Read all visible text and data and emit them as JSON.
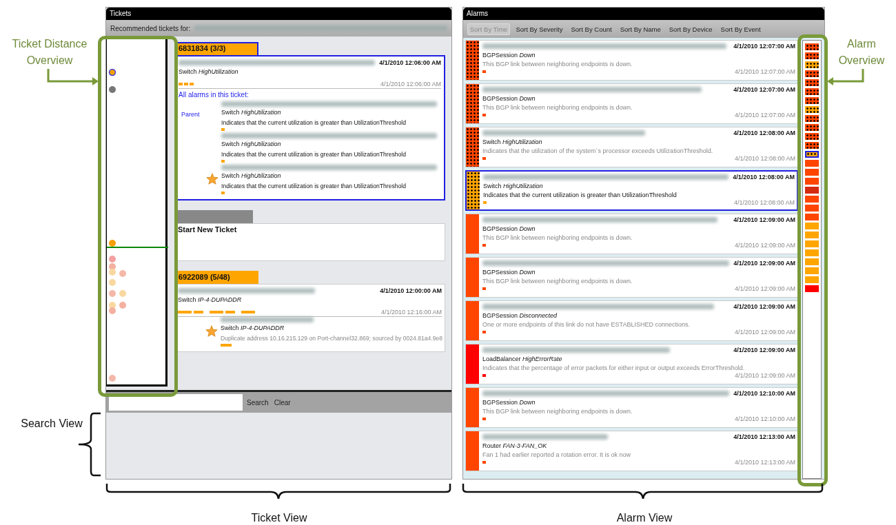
{
  "tickets_panel": {
    "title": "Tickets",
    "recommended_label": "Recommended tickets for:",
    "tickets": [
      {
        "kind": "ticket",
        "header": "6831834 (3/3)",
        "selected": true,
        "time": "4/1/2010 12:06:00 AM",
        "type": "Switch",
        "event": "HighUtilization",
        "dashes": [
          {
            "kind": "short"
          },
          {
            "kind": "short"
          },
          {
            "kind": "short"
          }
        ],
        "last_time": "4/1/2010 12:06:00 AM",
        "all_alarms_label": "All alarms in this ticket:",
        "alarms": [
          {
            "role": "Parent",
            "starred": false,
            "type": "Switch",
            "event": "HighUtilization",
            "description": "Indicates that the current utilization is greater than UtilizationThreshold"
          },
          {
            "starred": false,
            "type": "Switch",
            "event": "HighUtilization",
            "description": "Indicates that the current utilization is greater than UtilizationThreshold"
          },
          {
            "starred": true,
            "type": "Switch",
            "event": "HighUtilization",
            "description": "Indicates that the current utilization is greater than UtilizationThreshold"
          }
        ]
      },
      {
        "kind": "new",
        "title": "Start New Ticket"
      },
      {
        "kind": "ticket",
        "header": "6922089 (5/48)",
        "selected": false,
        "time": "4/1/2010 12:00:00 AM",
        "type": "Switch",
        "event": "IP-4-DUPADDR",
        "dashes": [
          {
            "kind": "long"
          },
          {
            "kind": "short"
          },
          {
            "kind": "long"
          },
          {
            "kind": "short"
          },
          {
            "kind": "long"
          }
        ],
        "last_time": "4/1/2010 12:16:00 AM",
        "alarms": [
          {
            "starred": true,
            "type": "Switch",
            "event": "IP-4-DUPADDR",
            "description": "Duplicate address 10.16.215.129 on Port-channel32.869; sourced by 0024.81a4.9e8"
          }
        ]
      }
    ],
    "search": {
      "button": "Search",
      "clear": "Clear"
    }
  },
  "alarms_panel": {
    "title": "Alarms",
    "sort_buttons": [
      {
        "label": "Sort By Time",
        "selected": true
      },
      {
        "label": "Sort By Severity",
        "selected": false
      },
      {
        "label": "Sort By Count",
        "selected": false
      },
      {
        "label": "Sort By Name",
        "selected": false
      },
      {
        "label": "Sort By Device",
        "selected": false
      },
      {
        "label": "Sort By Event",
        "selected": false
      }
    ],
    "alarms": [
      {
        "color": "#ff4500",
        "dotted": true,
        "selected": false,
        "time": "4/1/2010 12:07:00 AM",
        "type": "BGPSession",
        "event": "Down",
        "description": "This BGP link between neighboring endpoints is down.",
        "last_time": "4/1/2010 12:07:00 AM"
      },
      {
        "color": "#ff4500",
        "dotted": true,
        "selected": false,
        "time": "4/1/2010 12:07:00 AM",
        "type": "BGPSession",
        "event": "Down",
        "description": "This BGP link between neighboring endpoints is down.",
        "last_time": "4/1/2010 12:07:00 AM"
      },
      {
        "color": "#ff4500",
        "dotted": true,
        "selected": false,
        "time": "4/1/2010 12:08:00 AM",
        "type": "Switch",
        "event": "HighUtilization",
        "description": "Indicates that the utilization of the system`s processor exceeds UtilizationThreshold.",
        "last_time": "4/1/2010 12:08:00 AM"
      },
      {
        "color": "#ffa500",
        "dotted": true,
        "selected": true,
        "time": "4/1/2010 12:08:00 AM",
        "type": "Switch",
        "event": "HighUtilization",
        "description": "Indicates that the current utilization is greater than UtilizationThreshold",
        "last_time": "4/1/2010 12:08:00 AM"
      },
      {
        "color": "#ff4500",
        "dotted": false,
        "selected": false,
        "time": "4/1/2010 12:09:00 AM",
        "type": "BGPSession",
        "event": "Down",
        "description": "This BGP link between neighboring endpoints is down.",
        "last_time": "4/1/2010 12:09:00 AM"
      },
      {
        "color": "#ff4500",
        "dotted": false,
        "selected": false,
        "time": "4/1/2010 12:09:00 AM",
        "type": "BGPSession",
        "event": "Down",
        "description": "This BGP link between neighboring endpoints is down.",
        "last_time": "4/1/2010 12:09:00 AM"
      },
      {
        "color": "#ff4500",
        "dotted": false,
        "selected": false,
        "time": "4/1/2010 12:09:00 AM",
        "type": "BGPSession",
        "event": "Disconnected",
        "description": "One or more endpoints of this link do not have ESTABLISHED connections.",
        "last_time": "4/1/2010 12:09:00 AM"
      },
      {
        "color": "#ff0000",
        "dotted": false,
        "selected": false,
        "time": "4/1/2010 12:09:00 AM",
        "type": "LoadBalancer",
        "event": "HighErrorRate",
        "description": "Indicates that the percentage of error packets for either input or output exceeds ErrorThreshold.",
        "last_time": "4/1/2010 12:09:00 AM"
      },
      {
        "color": "#ff4500",
        "dotted": false,
        "selected": false,
        "time": "4/1/2010 12:10:00 AM",
        "type": "BGPSession",
        "event": "Down",
        "description": "This BGP link between neighboring endpoints is down.",
        "last_time": "4/1/2010 12:10:00 AM"
      },
      {
        "color": "#ff4500",
        "dotted": false,
        "selected": false,
        "time": "4/1/2010 12:13:00 AM",
        "type": "Router",
        "event": "FAN-3-FAN_OK",
        "description": "Fan 1 had earlier reported a rotation error. It is ok now",
        "last_time": "4/1/2010 12:13:00 AM"
      }
    ],
    "overview": [
      {
        "color": "#ff4500",
        "dotted": true,
        "selected": false
      },
      {
        "color": "#ff4500",
        "dotted": true,
        "selected": false
      },
      {
        "color": "#ffa500",
        "dotted": true,
        "selected": false
      },
      {
        "color": "#ff4500",
        "dotted": true,
        "selected": false
      },
      {
        "color": "#ff4500",
        "dotted": true,
        "selected": false
      },
      {
        "color": "#ff4500",
        "dotted": true,
        "selected": false
      },
      {
        "color": "#ff4500",
        "dotted": true,
        "selected": false
      },
      {
        "color": "#ffa500",
        "dotted": true,
        "selected": false
      },
      {
        "color": "#ff4500",
        "dotted": true,
        "selected": false
      },
      {
        "color": "#ff4500",
        "dotted": true,
        "selected": false
      },
      {
        "color": "#ff4500",
        "dotted": true,
        "selected": false
      },
      {
        "color": "#ff4500",
        "dotted": true,
        "selected": false
      },
      {
        "color": "#ffa500",
        "dotted": true,
        "selected": true
      },
      {
        "color": "#ff4500",
        "dotted": false,
        "selected": false
      },
      {
        "color": "#ff4500",
        "dotted": false,
        "selected": false
      },
      {
        "color": "#ff4500",
        "dotted": false,
        "selected": false
      },
      {
        "color": "#d42a10",
        "dotted": false,
        "selected": false
      },
      {
        "color": "#ff4500",
        "dotted": false,
        "selected": false
      },
      {
        "color": "#ff4500",
        "dotted": false,
        "selected": false
      },
      {
        "color": "#ff4500",
        "dotted": false,
        "selected": false
      },
      {
        "color": "#ffa500",
        "dotted": false,
        "selected": false
      },
      {
        "color": "#ffa500",
        "dotted": false,
        "selected": false
      },
      {
        "color": "#ffa500",
        "dotted": false,
        "selected": false
      },
      {
        "color": "#ffa500",
        "dotted": false,
        "selected": false
      },
      {
        "color": "#ffa500",
        "dotted": false,
        "selected": false
      },
      {
        "color": "#ffa500",
        "dotted": false,
        "selected": false
      },
      {
        "color": "#ffa500",
        "dotted": false,
        "selected": false
      },
      {
        "color": "#ff0000",
        "dotted": false,
        "selected": false
      }
    ]
  },
  "annotations": {
    "ticket_distance_overview": "Ticket Distance Overview",
    "alarm_overview": "Alarm Overview",
    "search_view": "Search View",
    "ticket_view": "Ticket View",
    "alarm_view": "Alarm View"
  }
}
